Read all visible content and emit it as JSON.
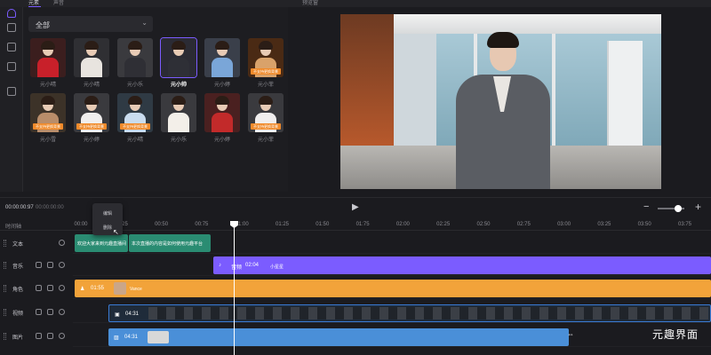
{
  "top": {
    "tab_active": "元素",
    "tab_other": "声音",
    "preview_tab": "预览窗"
  },
  "left_panel": {
    "filter_select": "全部",
    "avatars": [
      {
        "name": "元小晴",
        "tag": ""
      },
      {
        "name": "元小晴",
        "tag": ""
      },
      {
        "name": "元小乐",
        "tag": ""
      },
      {
        "name": "元小帅",
        "tag": "",
        "selected": true
      },
      {
        "name": "元小婷",
        "tag": ""
      },
      {
        "name": "元小菲",
        "tag": "不支持更换背景"
      },
      {
        "name": "元小雪",
        "tag": "不支持更换背景"
      },
      {
        "name": "元小婷",
        "tag": "不支持更换背景"
      },
      {
        "name": "元小晴",
        "tag": "不支持更换背景"
      },
      {
        "name": "元小乐",
        "tag": ""
      },
      {
        "name": "元小婷",
        "tag": ""
      },
      {
        "name": "元小菲",
        "tag": "不支持更换背景"
      }
    ]
  },
  "controls": {
    "current_time": "00:00:00:97",
    "total_time": "00:00:00:00",
    "play_icon": "play-icon",
    "zoom_minus": "−",
    "zoom_plus": "+"
  },
  "context_menu": {
    "items": [
      "编辑",
      "删除"
    ]
  },
  "timeline": {
    "ruler_title": "时间轴",
    "ticks": [
      "00:00",
      "00:25",
      "00:50",
      "00:75",
      "01:00",
      "01:25",
      "01:50",
      "01:75",
      "02:00",
      "02:25",
      "02:50",
      "02:75",
      "03:00",
      "03:25",
      "03:50",
      "03:75"
    ],
    "tracks": [
      {
        "name": "文本"
      },
      {
        "name": "音乐"
      },
      {
        "name": "角色"
      },
      {
        "name": "视频"
      },
      {
        "name": "图片"
      }
    ],
    "text_clips": [
      "欢迎大家来到元趣直播间",
      "本次直播的内容是如何使用元趣平台"
    ],
    "music_clip": {
      "duration": "02:04",
      "name": "小星星"
    },
    "role_clip": {
      "duration": "01:55",
      "name": "Vance"
    },
    "video_clip": {
      "duration": "04:31"
    },
    "image_clip": {
      "duration": "04:31"
    }
  },
  "watermark": "元趣界面",
  "colors": {
    "accent": "#7b5cff",
    "text_track": "#2a8c72",
    "music_track": "#7b5cff",
    "role_track": "#f2a33a",
    "video_track": "#3a7bd5",
    "image_track": "#4a8fd8"
  }
}
